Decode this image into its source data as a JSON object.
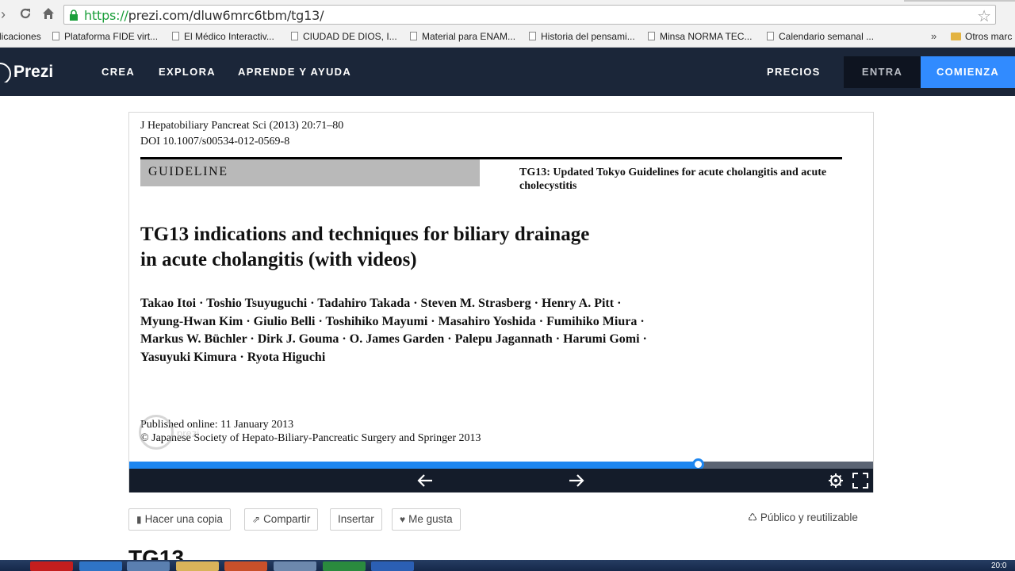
{
  "browser": {
    "url_protocol": "https://",
    "url_host_path": "prezi.com/dluw6mrc6tbm/tg13/",
    "bookmarks": [
      {
        "label": "licaciones",
        "type": "page"
      },
      {
        "label": "Plataforma FIDE virt...",
        "type": "page"
      },
      {
        "label": "El Médico Interactiv...",
        "type": "page"
      },
      {
        "label": "CIUDAD DE DIOS, I...",
        "type": "page"
      },
      {
        "label": "Material para ENAM...",
        "type": "page"
      },
      {
        "label": "Historia del pensami...",
        "type": "page"
      },
      {
        "label": "Minsa NORMA TEC...",
        "type": "page"
      },
      {
        "label": "Calendario semanal ...",
        "type": "page"
      },
      {
        "label": "Otros marc",
        "type": "folder"
      }
    ],
    "bookmarks_more": "»"
  },
  "header": {
    "logo_text": "Prezi",
    "nav": [
      "CREA",
      "EXPLORA",
      "APRENDE Y AYUDA"
    ],
    "pricing": "PRECIOS",
    "login": "ENTRA",
    "signup": "COMIENZA"
  },
  "slide": {
    "journal": "J Hepatobiliary Pancreat Sci (2013) 20:71–80",
    "doi": "DOI 10.1007/s00534-012-0569-8",
    "section": "GUIDELINE",
    "series_title": "TG13: Updated Tokyo Guidelines for acute cholangitis and acute cholecystitis",
    "title_line1": "TG13 indications and techniques for biliary drainage",
    "title_line2": "in acute cholangitis (with videos)",
    "authors": [
      "Takao Itoi · Toshio Tsuyuguchi · Tadahiro Takada · Steven M. Strasberg · Henry A. Pitt ·",
      "Myung-Hwan Kim · Giulio Belli · Toshihiko Mayumi · Masahiro Yoshida · Fumihiko Miura ·",
      "Markus W. Büchler · Dirk J. Gouma · O. James Garden · Palepu Jagannath · Harumi Gomi ·",
      "Yasuyuki Kimura · Ryota Higuchi"
    ],
    "published": "Published online: 11 January 2013",
    "copyright": "© Japanese Society of Hepato-Biliary-Pancreatic Surgery and Springer 2013",
    "watermark": "prezi"
  },
  "player": {
    "progress_fraction": 0.764
  },
  "actions": {
    "copy": "Hacer una copia",
    "share": "Compartir",
    "embed": "Insertar",
    "like": "Me gusta",
    "visibility": "Público y reutilizable"
  },
  "below": {
    "title_partial": "TG13"
  },
  "taskbar": {
    "clock": "20:0"
  }
}
